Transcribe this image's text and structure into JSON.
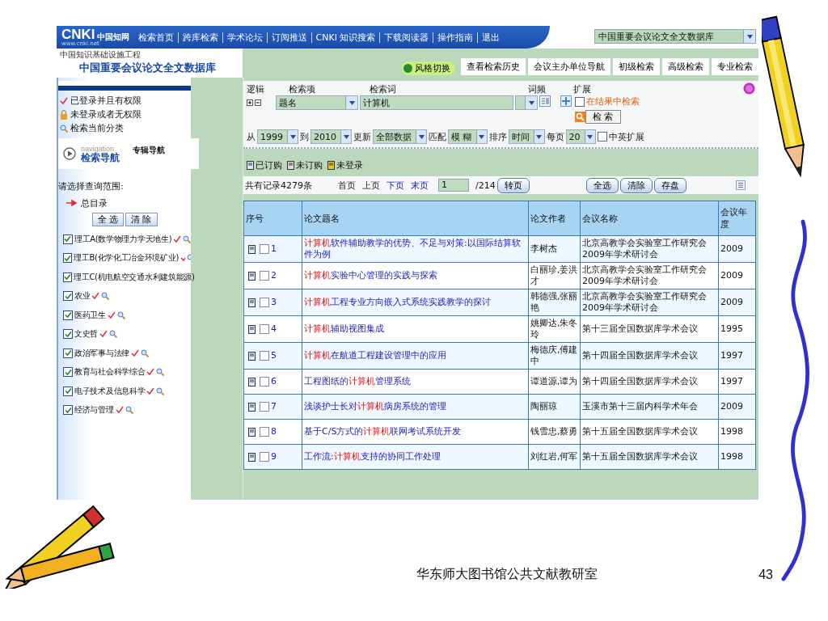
{
  "header": {
    "logo": {
      "mark": "CNKI",
      "name": "中国知网",
      "url": "www.cnki.net"
    },
    "nav_links": [
      "检索首页",
      "跨库检索",
      "学术论坛",
      "订阅推送",
      "CNKI 知识搜索",
      "下载阅读器",
      "操作指南",
      "退出"
    ],
    "database_select": "中国重要会议论文全文数据库",
    "tagline": "中国知识基础设施工程",
    "page_title": "中国重要会议论文全文数据库",
    "style_switch": "风格切换",
    "tabs": [
      "查看检索历史",
      "会议主办单位导航",
      "初级检索",
      "高级检索",
      "专业检索"
    ]
  },
  "sidebar": {
    "legend": [
      {
        "kind": "tick",
        "label": "已登录并且有权限"
      },
      {
        "kind": "lock",
        "label": "未登录或者无权限"
      },
      {
        "kind": "search",
        "label": "检索当前分类"
      }
    ],
    "navigation": {
      "caption": "navigation",
      "title": "检索导航",
      "tab": "专辑导航"
    },
    "scope_label": "请选择查询范围:",
    "root": "总目录",
    "buttons": [
      "全 选",
      "清 除"
    ],
    "categories": [
      {
        "label": "理工A(数学物理力学天地生)",
        "checked": true
      },
      {
        "label": "理工B(化学化工冶金环境矿业)",
        "checked": true
      },
      {
        "label": "理工C(机电航空交通水利建筑能源)",
        "checked": true
      },
      {
        "label": "农业",
        "checked": true
      },
      {
        "label": "医药卫生",
        "checked": true
      },
      {
        "label": "文史哲",
        "checked": true
      },
      {
        "label": "政治军事与法律",
        "checked": true
      },
      {
        "label": "教育与社会科学综合",
        "checked": true
      },
      {
        "label": "电子技术及信息科学",
        "checked": true
      },
      {
        "label": "经济与管理",
        "checked": true
      }
    ]
  },
  "search": {
    "headers": [
      "逻辑",
      "检索项",
      "检索词",
      "词频",
      "扩展"
    ],
    "field": "题名",
    "term": "计算机",
    "in_results": {
      "label": "在结果中检索",
      "checked": false
    },
    "search_button": "检 索",
    "filters": [
      {
        "label": "从",
        "value": "1999"
      },
      {
        "label": "到",
        "value": "2010"
      },
      {
        "label": "更新",
        "value": "全部数据"
      },
      {
        "label": "匹配",
        "value": "模 糊"
      },
      {
        "label": "排序",
        "value": "时间"
      },
      {
        "label": "每页",
        "value": "20"
      }
    ],
    "bilingual": {
      "label": "中英扩展",
      "checked": false
    }
  },
  "purchase_legend": [
    {
      "kind": "bought",
      "label": "已订购"
    },
    {
      "kind": "unbought",
      "label": "未订购"
    },
    {
      "kind": "guest",
      "label": "未登录"
    }
  ],
  "pager": {
    "total": "共有记录4279条",
    "links": [
      {
        "label": "首页",
        "disabled": true
      },
      {
        "label": "上页",
        "disabled": true
      },
      {
        "label": "下页",
        "disabled": false
      },
      {
        "label": "末页",
        "disabled": false
      }
    ],
    "page": "1",
    "pages": "/214",
    "go": "转页",
    "actions": [
      "全选",
      "清除",
      "存盘"
    ]
  },
  "table": {
    "columns": [
      "序号",
      "论文题名",
      "论文作者",
      "会议名称",
      "会议年度"
    ],
    "rows": [
      {
        "no": "1",
        "checked": false,
        "title": [
          {
            "text": "计算机",
            "hit": true
          },
          {
            "text": "软件辅助教学的优势、不足与对策:以国际结算软件为例",
            "hit": false
          }
        ],
        "author": "李树杰",
        "conference": "北京高教学会实验室工作研究会2009年学术研讨会",
        "year": "2009"
      },
      {
        "no": "2",
        "checked": false,
        "title": [
          {
            "text": "计算机",
            "hit": true
          },
          {
            "text": "实验中心管理的实践与探索",
            "hit": false
          }
        ],
        "author": "白丽珍,姜洪才",
        "conference": "北京高教学会实验室工作研究会2009年学术研讨会",
        "year": "2009"
      },
      {
        "no": "3",
        "checked": false,
        "title": [
          {
            "text": "计算机",
            "hit": true
          },
          {
            "text": "工程专业方向嵌入式系统实践教学的探讨",
            "hit": false
          }
        ],
        "author": "韩德强,张丽艳",
        "conference": "北京高教学会实验室工作研究会2009年学术研讨会",
        "year": "2009"
      },
      {
        "no": "4",
        "checked": false,
        "title": [
          {
            "text": "计算机",
            "hit": true
          },
          {
            "text": "辅助视图集成",
            "hit": false
          }
        ],
        "author": "姚卿达,朱冬玲",
        "conference": "第十三届全国数据库学术会议",
        "year": "1995"
      },
      {
        "no": "5",
        "checked": false,
        "title": [
          {
            "text": "计算机",
            "hit": true
          },
          {
            "text": "在航道工程建设管理中的应用",
            "hit": false
          }
        ],
        "author": "梅德庆,傅建中",
        "conference": "第十四届全国数据库学术会议",
        "year": "1997"
      },
      {
        "no": "6",
        "checked": false,
        "title": [
          {
            "text": "工程图纸的",
            "hit": false
          },
          {
            "text": "计算机",
            "hit": true
          },
          {
            "text": "管理系统",
            "hit": false
          }
        ],
        "author": "谭道源,谭为",
        "conference": "第十四届全国数据库学术会议",
        "year": "1997"
      },
      {
        "no": "7",
        "checked": false,
        "title": [
          {
            "text": "浅谈护士长对",
            "hit": false
          },
          {
            "text": "计算机",
            "hit": true
          },
          {
            "text": "病房系统的管理",
            "hit": false
          }
        ],
        "author": "陶丽琼",
        "conference": "玉溪市第十三届内科学术年会",
        "year": "2009"
      },
      {
        "no": "8",
        "checked": false,
        "title": [
          {
            "text": "基于C/S方式的",
            "hit": false
          },
          {
            "text": "计算机",
            "hit": true
          },
          {
            "text": "联网考试系统开发",
            "hit": false
          }
        ],
        "author": "钱雪忠,蔡勇",
        "conference": "第十五届全国数据库学术会议",
        "year": "1998"
      },
      {
        "no": "9",
        "checked": false,
        "title": [
          {
            "text": "工作流:",
            "hit": false
          },
          {
            "text": "计算机",
            "hit": true
          },
          {
            "text": "支持的协同工作处理",
            "hit": false
          }
        ],
        "author": "刘红岩,何军",
        "conference": "第十五届全国数据库学术会议",
        "year": "1998"
      }
    ]
  },
  "footer": {
    "caption": "华东师大图书馆公共文献教研室",
    "page_number": "43"
  }
}
